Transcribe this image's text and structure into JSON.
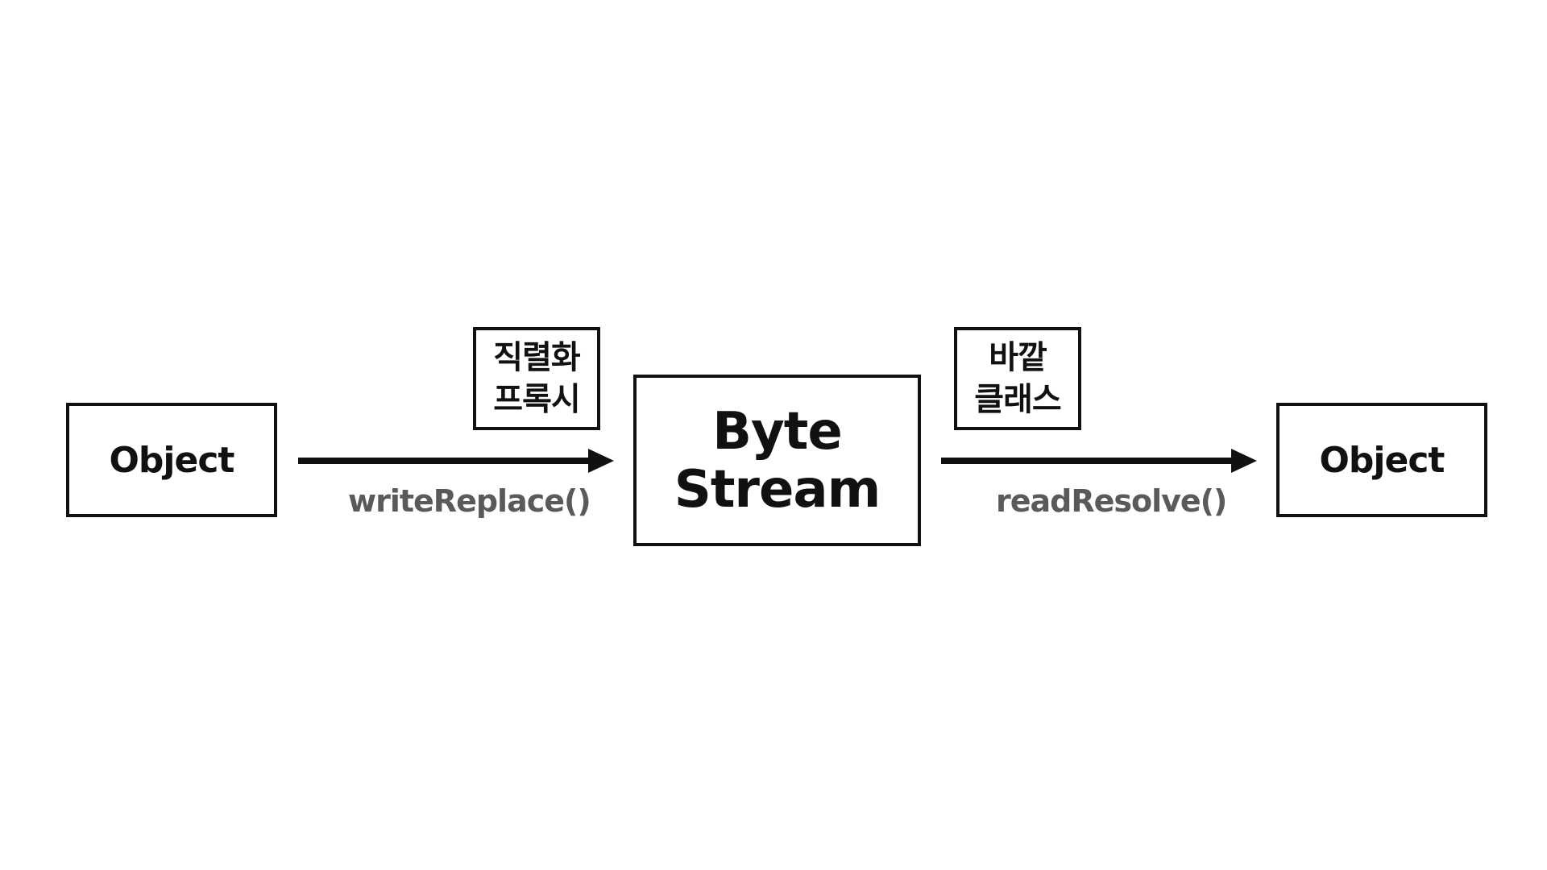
{
  "diagram": {
    "left_object": {
      "label": "Object"
    },
    "serialization_proxy_label": {
      "line1": "직렬화",
      "line2": "프록시"
    },
    "write_arrow": {
      "method": "writeReplace()"
    },
    "byte_stream": {
      "line1": "Byte",
      "line2": "Stream"
    },
    "outer_class_label": {
      "line1": "바깥",
      "line2": "클래스"
    },
    "read_arrow": {
      "method": "readResolve()"
    },
    "right_object": {
      "label": "Object"
    }
  },
  "colors": {
    "stroke": "#111111",
    "method_text": "#5a5a5a",
    "background": "#ffffff"
  }
}
